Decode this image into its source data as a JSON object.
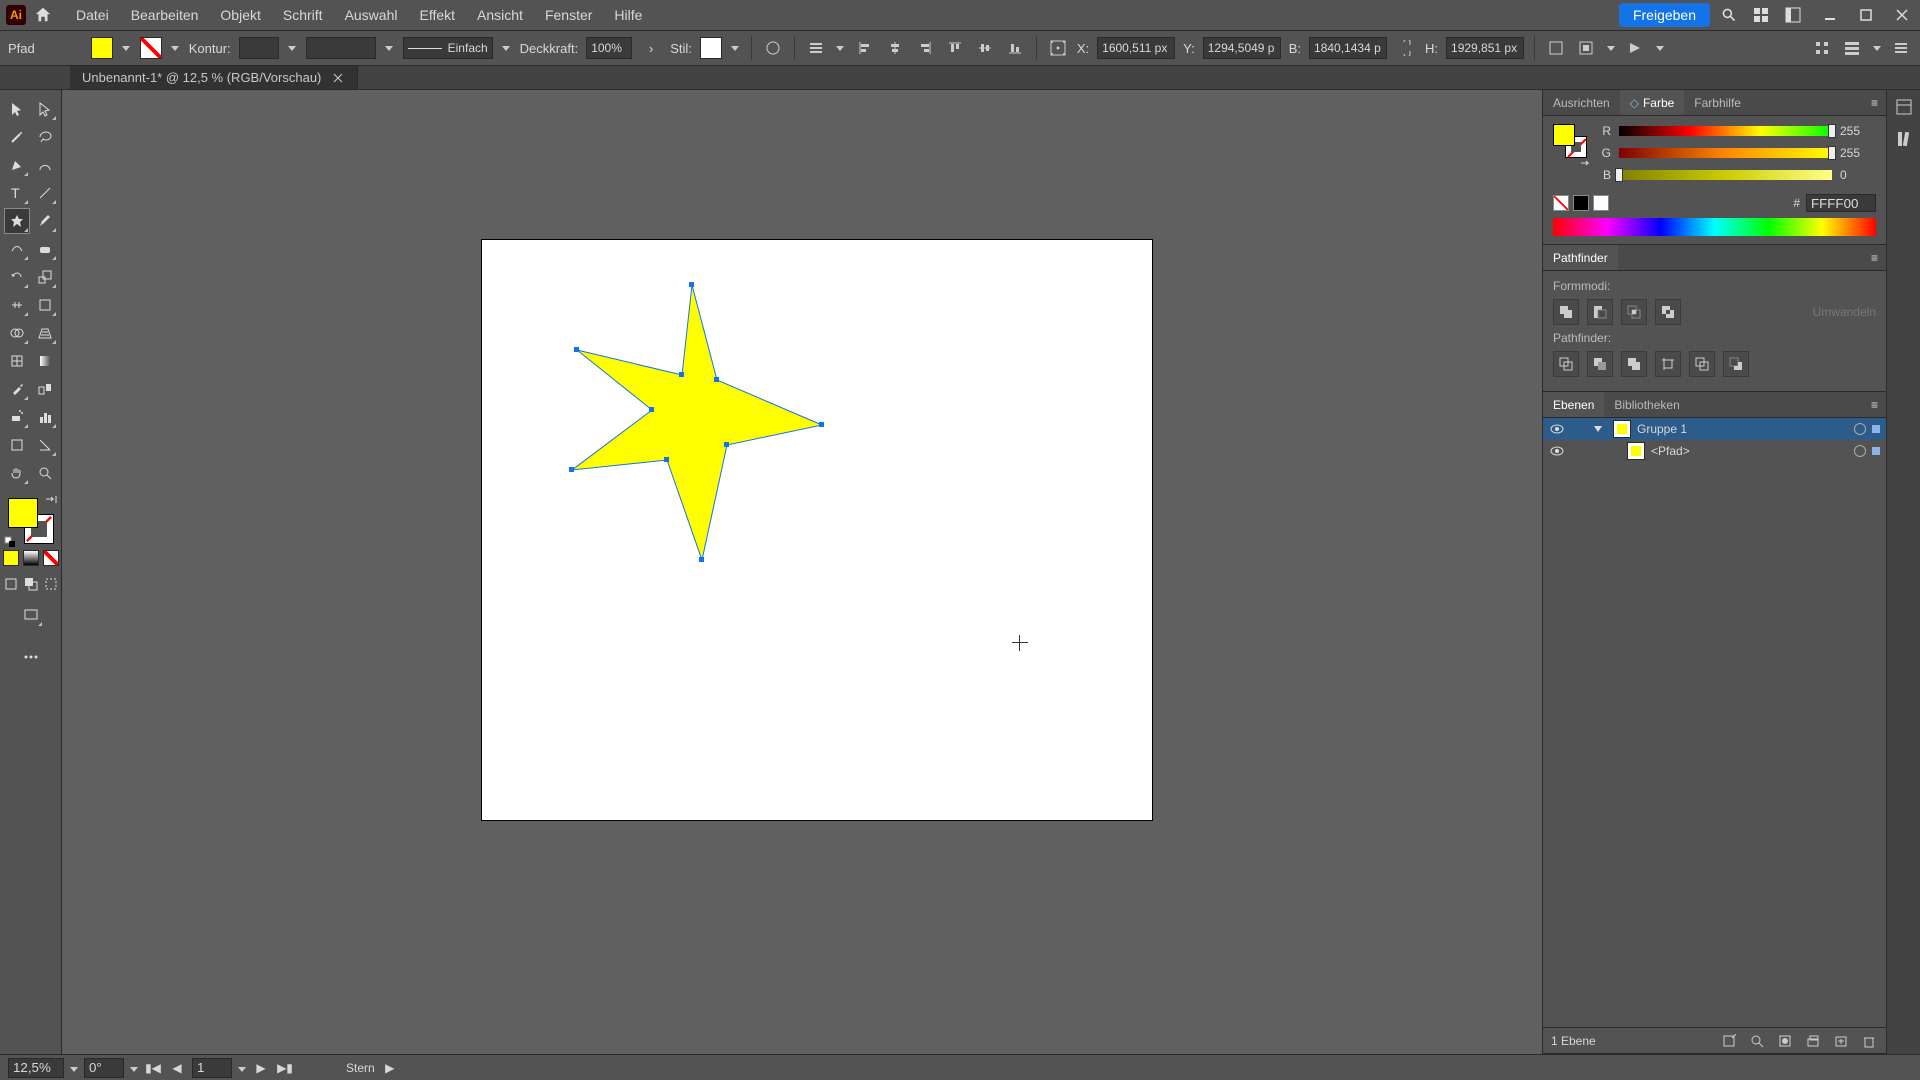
{
  "app": {
    "short": "Ai"
  },
  "menu": {
    "items": [
      "Datei",
      "Bearbeiten",
      "Objekt",
      "Schrift",
      "Auswahl",
      "Effekt",
      "Ansicht",
      "Fenster",
      "Hilfe"
    ]
  },
  "share_label": "Freigeben",
  "optbar": {
    "selection_type": "Pfad",
    "stroke_label": "Kontur:",
    "stroke_val": "",
    "brush_name": "Einfach",
    "opacity_label": "Deckkraft:",
    "opacity_val": "100%",
    "style_label": "Stil:",
    "x_label": "X:",
    "x_val": "1600,511 px",
    "y_label": "Y:",
    "y_val": "1294,5049 p",
    "w_label": "B:",
    "w_val": "1840,1434 p",
    "h_label": "H:",
    "h_val": "1929,851 px"
  },
  "doc": {
    "tab_title": "Unbenannt-1* @ 12,5 % (RGB/Vorschau)"
  },
  "color": {
    "tabs": [
      "Ausrichten",
      "Farbe",
      "Farbhilfe"
    ],
    "r_label": "R",
    "r_val": "255",
    "g_label": "G",
    "g_val": "255",
    "b_label": "B",
    "b_val": "0",
    "hex_label": "#",
    "hex_val": "FFFF00"
  },
  "pathfinder": {
    "title": "Pathfinder",
    "shape_modes_label": "Formmodi:",
    "expand_label": "Umwandeln",
    "pathfinder_label": "Pathfinder:"
  },
  "layers": {
    "tabs": [
      "Ebenen",
      "Bibliotheken"
    ],
    "items": [
      {
        "name": "Gruppe 1",
        "indent": 0,
        "selected": true,
        "twisty": true
      },
      {
        "name": "<Pfad>",
        "indent": 1,
        "selected": false,
        "twisty": false
      }
    ],
    "footer_count": "1 Ebene"
  },
  "status": {
    "zoom": "12,5%",
    "rotate": "0°",
    "artboard": "1",
    "tool": "Stern"
  }
}
